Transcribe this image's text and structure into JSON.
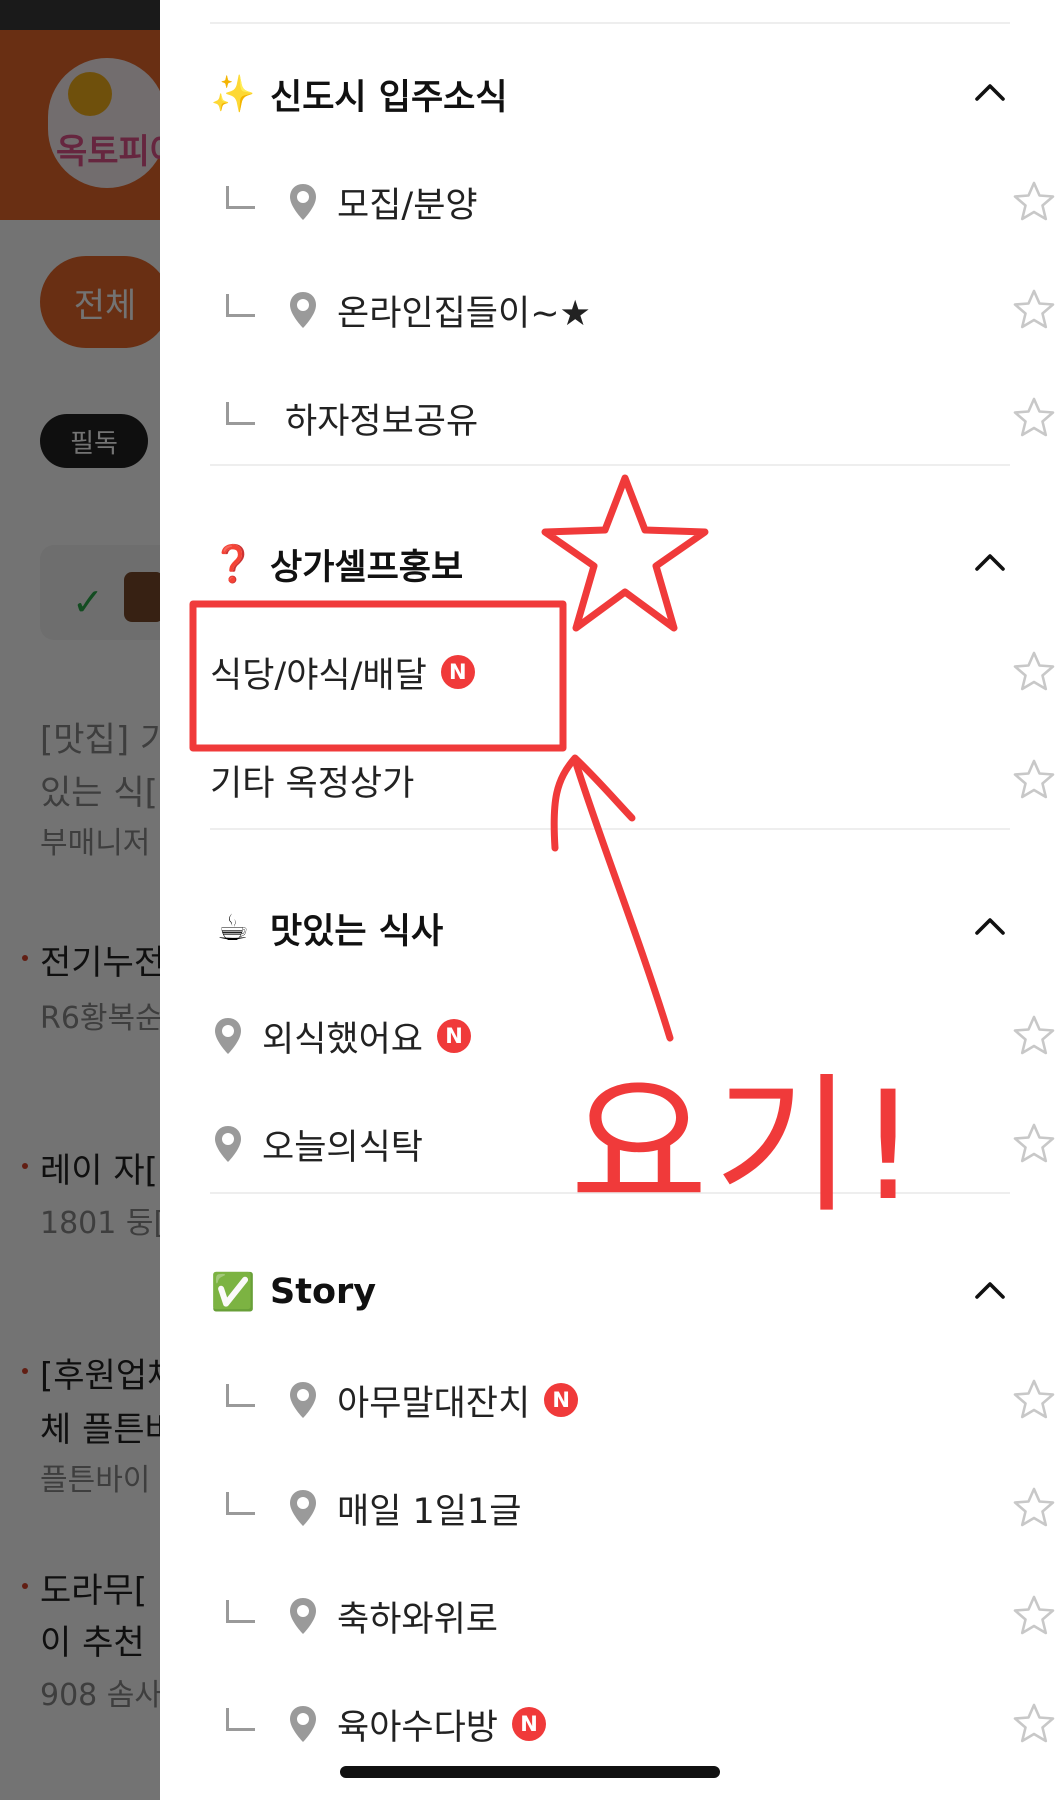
{
  "background": {
    "chip_all": "전체",
    "badge_must_read": "필독",
    "partial_texts": [
      {
        "text": "[맛집] 기",
        "gray": true
      },
      {
        "text": "있는 식[",
        "gray": true
      },
      {
        "text": "부매니저",
        "gray": true
      },
      {
        "text": "전기누전",
        "gray": false
      },
      {
        "text": "R6황복순",
        "gray": true
      },
      {
        "text": "레이 자[",
        "gray": false
      },
      {
        "text": "1801 둥[",
        "gray": true
      },
      {
        "text": "[후원업체",
        "gray": false
      },
      {
        "text": "체 플튼바",
        "gray": false
      },
      {
        "text": "플튼바이",
        "gray": true
      },
      {
        "text": "도라무[",
        "gray": false
      },
      {
        "text": "이 추천",
        "gray": false
      },
      {
        "text": "908 솜사",
        "gray": true
      }
    ]
  },
  "drawer": {
    "sections": [
      {
        "emoji": "✨",
        "title": "신도시 입주소식",
        "items": [
          {
            "label": "모집/분양",
            "branch": true,
            "pin": true,
            "new": false
          },
          {
            "label": "온라인집들이~★",
            "branch": true,
            "pin": true,
            "new": false
          },
          {
            "label": "하자정보공유",
            "branch": true,
            "pin": false,
            "new": false
          }
        ]
      },
      {
        "emoji": "❓",
        "title": "상가셀프홍보",
        "items": [
          {
            "label": "식당/야식/배달",
            "branch": false,
            "pin": false,
            "new": true
          },
          {
            "label": "기타 옥정상가",
            "branch": false,
            "pin": false,
            "new": false
          }
        ]
      },
      {
        "emoji": "☕",
        "title": "맛있는 식사",
        "items": [
          {
            "label": "외식했어요",
            "branch": false,
            "pin": true,
            "new": true
          },
          {
            "label": "오늘의식탁",
            "branch": false,
            "pin": true,
            "new": false
          }
        ]
      },
      {
        "emoji": "✅",
        "title": "Story",
        "items": [
          {
            "label": "아무말대잔치",
            "branch": true,
            "pin": true,
            "new": true
          },
          {
            "label": "매일 1일1글",
            "branch": true,
            "pin": true,
            "new": false
          },
          {
            "label": "축하와위로",
            "branch": true,
            "pin": true,
            "new": false
          },
          {
            "label": "육아수다방",
            "branch": true,
            "pin": true,
            "new": true
          }
        ]
      }
    ],
    "new_badge_text": "N"
  },
  "annotation": {
    "handwritten_text": "요기!",
    "color": "#f03a3a"
  },
  "colors": {
    "accent_orange": "#e8692c",
    "new_badge": "#f03a3a",
    "icon_gray": "#9a9a9a"
  }
}
